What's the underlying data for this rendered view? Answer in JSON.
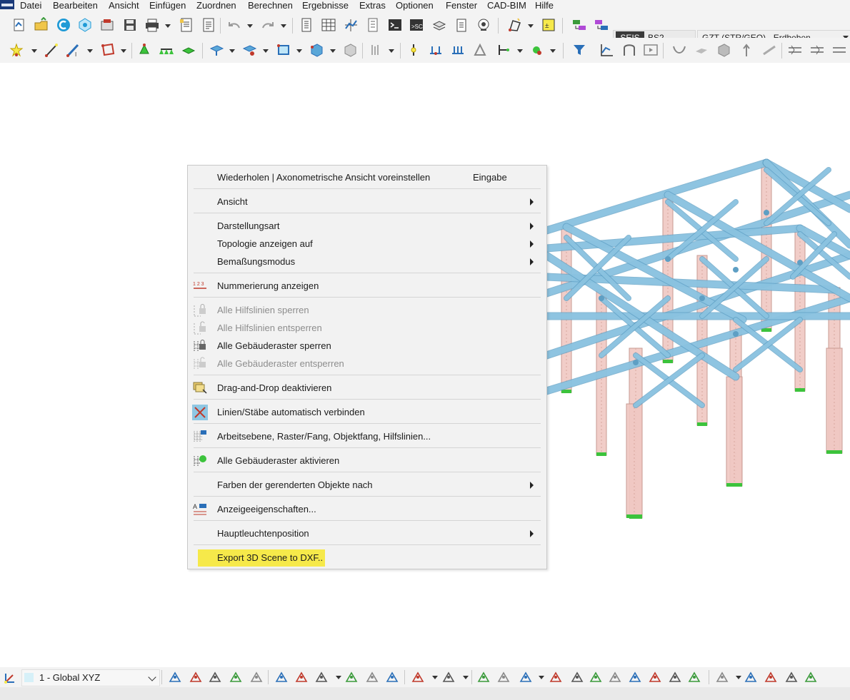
{
  "menubar": {
    "items": [
      "Datei",
      "Bearbeiten",
      "Ansicht",
      "Einfügen",
      "Zuordnen",
      "Berechnen",
      "Ergebnisse",
      "Extras",
      "Optionen",
      "Fenster",
      "CAD-BIM",
      "Hilfe"
    ]
  },
  "toolbar": {
    "load_case_type": "SEIS",
    "load_combo": "BS2",
    "design_situation": "GZT (STR/GEO) - Erdbeben"
  },
  "context_menu": {
    "items": [
      {
        "label": "Wiederholen | Axonometrische Ansicht voreinstellen",
        "shortcut": "Eingabe",
        "submenu": false,
        "enabled": true,
        "icon": ""
      },
      {
        "label": "Ansicht",
        "submenu": true,
        "enabled": true,
        "icon": ""
      },
      {
        "label": "Darstellungsart",
        "submenu": true,
        "enabled": true,
        "icon": ""
      },
      {
        "label": "Topologie anzeigen auf",
        "submenu": true,
        "enabled": true,
        "icon": ""
      },
      {
        "label": "Bemaßungsmodus",
        "submenu": true,
        "enabled": true,
        "icon": ""
      },
      {
        "label": "Nummerierung anzeigen",
        "submenu": false,
        "enabled": true,
        "icon": "numbering-icon"
      },
      {
        "label": "Alle Hilfslinien sperren",
        "submenu": false,
        "enabled": false,
        "icon": "lock-guidelines-icon"
      },
      {
        "label": "Alle Hilfslinien entsperren",
        "submenu": false,
        "enabled": false,
        "icon": "unlock-guidelines-icon"
      },
      {
        "label": "Alle Gebäuderaster sperren",
        "submenu": false,
        "enabled": true,
        "icon": "lock-grid-icon"
      },
      {
        "label": "Alle Gebäuderaster entsperren",
        "submenu": false,
        "enabled": false,
        "icon": "unlock-grid-icon"
      },
      {
        "label": "Drag-and-Drop deaktivieren",
        "submenu": false,
        "enabled": true,
        "icon": "drag-drop-icon"
      },
      {
        "label": "Linien/Stäbe automatisch verbinden",
        "submenu": false,
        "enabled": true,
        "icon": "auto-connect-icon"
      },
      {
        "label": "Arbeitsebene, Raster/Fang, Objektfang, Hilfslinien...",
        "submenu": false,
        "enabled": true,
        "icon": "work-plane-icon"
      },
      {
        "label": "Alle Gebäuderaster aktivieren",
        "submenu": false,
        "enabled": true,
        "icon": "activate-grid-icon"
      },
      {
        "label": "Farben der gerenderten Objekte nach",
        "submenu": true,
        "enabled": true,
        "icon": ""
      },
      {
        "label": "Anzeigeeigenschaften...",
        "submenu": false,
        "enabled": true,
        "icon": "display-properties-icon"
      },
      {
        "label": "Hauptleuchtenposition",
        "submenu": true,
        "enabled": true,
        "icon": ""
      },
      {
        "label": "Export 3D Scene to DXF..",
        "submenu": false,
        "enabled": true,
        "highlight": true,
        "icon": ""
      }
    ]
  },
  "statusbar": {
    "coordinate_system": "1 - Global XYZ"
  },
  "colors": {
    "member_blue": "#8fc7e3",
    "column_pink": "#f0c8c2",
    "support_green": "#3cc33c",
    "highlight_yellow": "#f6e94a"
  }
}
